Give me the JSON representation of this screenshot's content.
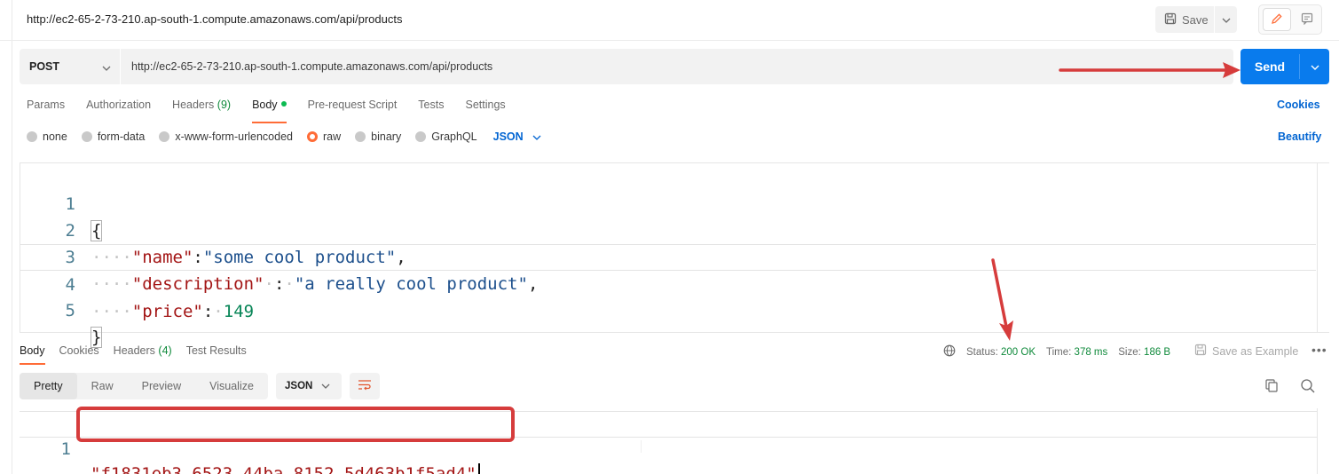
{
  "window": {
    "title": "http://ec2-65-2-73-210.ap-south-1.compute.amazonaws.com/api/products",
    "save_label": "Save"
  },
  "request": {
    "method": "POST",
    "url": "http://ec2-65-2-73-210.ap-south-1.compute.amazonaws.com/api/products",
    "send_label": "Send"
  },
  "request_tabs": {
    "params": "Params",
    "authorization": "Authorization",
    "headers": "Headers",
    "headers_count": "(9)",
    "body": "Body",
    "prerequest": "Pre-request Script",
    "tests": "Tests",
    "settings": "Settings",
    "cookies": "Cookies"
  },
  "body_types": {
    "none": "none",
    "form_data": "form-data",
    "urlencoded": "x-www-form-urlencoded",
    "raw": "raw",
    "binary": "binary",
    "graphql": "GraphQL",
    "language": "JSON",
    "beautify": "Beautify"
  },
  "editor": {
    "lines": [
      "1",
      "2",
      "3",
      "4",
      "5"
    ],
    "open_brace": "{",
    "close_brace": "}",
    "indent": "····",
    "key_name": "\"name\"",
    "val_name": "\"some cool product\"",
    "key_description": "\"description\"",
    "val_description": "\"a really cool product\"",
    "key_price": "\"price\"",
    "val_price": "149"
  },
  "response": {
    "tabs": {
      "body": "Body",
      "cookies": "Cookies",
      "headers": "Headers",
      "headers_count": "(4)",
      "test_results": "Test Results"
    },
    "status_label": "Status:",
    "status_value": "200 OK",
    "time_label": "Time:",
    "time_value": "378 ms",
    "size_label": "Size:",
    "size_value": "186 B",
    "save_example": "Save as Example",
    "more": "•••",
    "views": {
      "pretty": "Pretty",
      "raw": "Raw",
      "preview": "Preview",
      "visualize": "Visualize"
    },
    "format": "JSON",
    "line_number": "1",
    "body_value": "\"f1831eb3-6523-44ba-8152-5d463b1f5ad4\""
  },
  "colors": {
    "send_blue": "#097bed",
    "link_blue": "#0265d2",
    "status_green": "#0f8a3b",
    "active_orange": "#ff6c37",
    "annotation_red": "#d63c3c"
  }
}
